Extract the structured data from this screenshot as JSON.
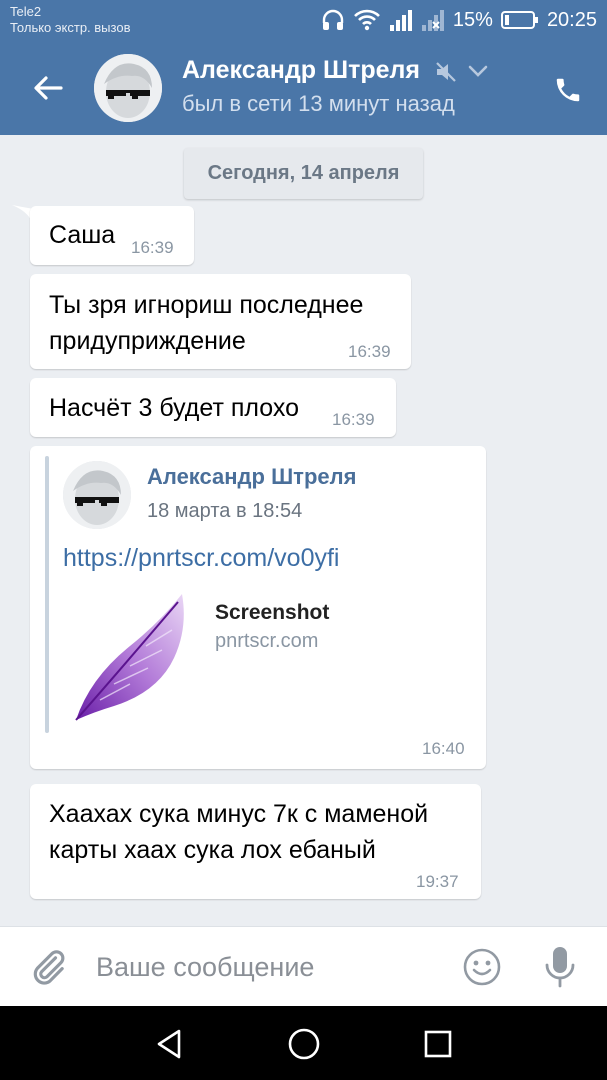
{
  "status_bar": {
    "carrier": "Tele2",
    "carrier_note": "Только экстр. вызов",
    "battery_percent": "15%",
    "time": "20:25"
  },
  "header": {
    "contact_name": "Александр Штреля",
    "last_seen": "был в сети 13 минут назад"
  },
  "chat": {
    "date_label": "Сегодня, 14 апреля",
    "messages": [
      {
        "text": "Саша",
        "time": "16:39"
      },
      {
        "lines": [
          "Ты зря игнориш последнее",
          "придуприждение"
        ],
        "time": "16:39"
      },
      {
        "text": "Насчёт 3 будет плохо",
        "time": "16:39"
      },
      {
        "forwarded": {
          "author": "Александр Штреля",
          "date": "18 марта в 18:54",
          "link": "https://pnrtscr.com/vo0yfi",
          "preview_title": "Screenshot",
          "preview_domain": "pnrtscr.com"
        },
        "time": "16:40"
      },
      {
        "lines": [
          "Хаахах сука минус 7к с маменой",
          "карты хаах сука лох ебаный"
        ],
        "time": "19:37"
      }
    ]
  },
  "composer": {
    "placeholder": "Ваше сообщение"
  },
  "colors": {
    "header": "#4a76a8",
    "background": "#ebeef2",
    "link": "#3d6ea5"
  }
}
